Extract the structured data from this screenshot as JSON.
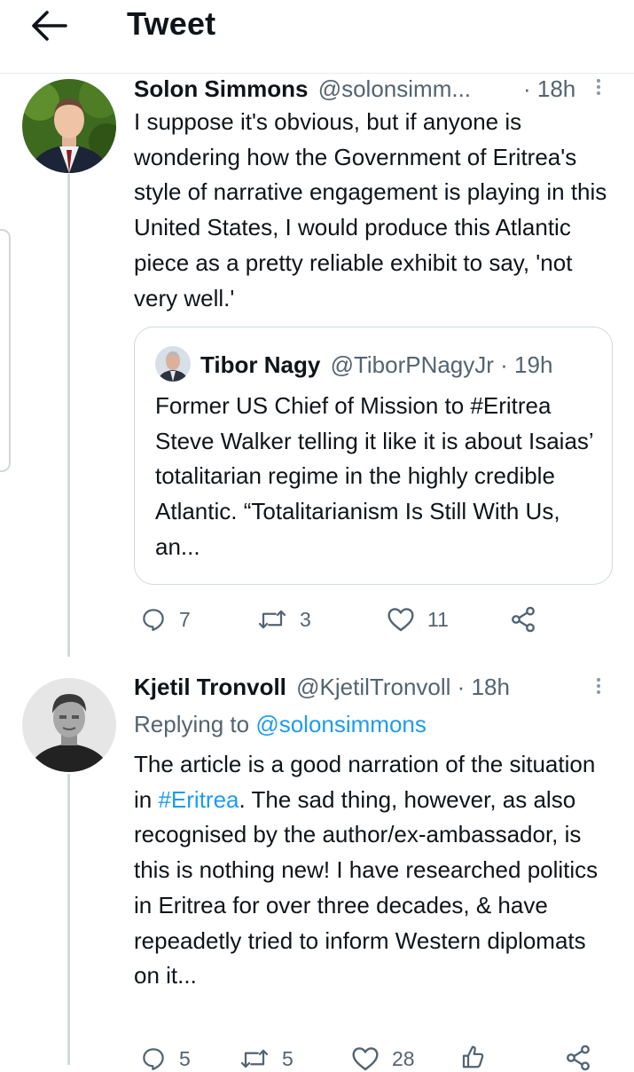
{
  "header": {
    "title": "Tweet",
    "back_icon": "arrow-left-icon"
  },
  "tweets": [
    {
      "author_name": "Solon Simmons",
      "handle": "@solonsimm...",
      "time": "· 18h",
      "text": "I suppose it's obvious, but if anyone is wondering how the Government of Eritrea's style of narrative engagement is playing in this United States, I would produce this Atlantic piece as a pretty reliable exhibit to say, 'not very well.'",
      "quote": {
        "author_name": "Tibor Nagy",
        "handle": "@TiborPNagyJr",
        "time": "· 19h",
        "text": "Former US Chief of Mission to #Eritrea Steve Walker telling it like it is about Isaias’ totalitarian regime in the highly credible Atlantic. “Totalitarianism Is Still With Us, an..."
      },
      "actions": {
        "replies": "7",
        "retweets": "3",
        "likes": "11"
      }
    },
    {
      "author_name": "Kjetil Tronvoll",
      "handle": "@KjetilTronvoll",
      "time": "· 18h",
      "replying_to_label": "Replying to",
      "replying_to_handle": "@solonsimmons",
      "text_part1": "The article is a good narration of the situation in ",
      "hashtag": "#Eritrea",
      "text_part2": ". The sad thing, however, as also recognised by the author/ex-ambassador, is this is nothing new! I have researched politics in Eritrea for over three decades, & have repeadetly tried to inform Western diplomats on it...",
      "actions": {
        "replies": "5",
        "retweets": "5",
        "likes": "28"
      }
    }
  ],
  "colors": {
    "link": "#1d9bf0",
    "muted": "#536471",
    "text": "#0f1419",
    "line": "#cfd9de"
  }
}
